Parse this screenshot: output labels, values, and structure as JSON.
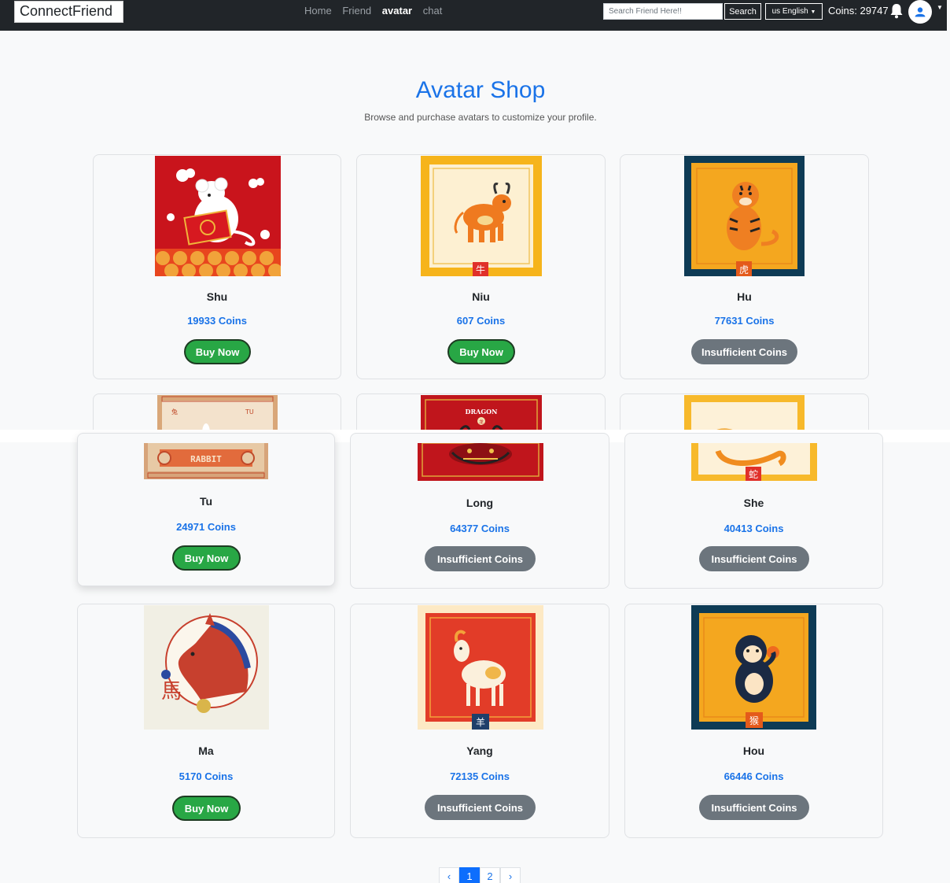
{
  "navbar": {
    "brand": "ConnectFriend",
    "links": [
      {
        "label": "Home",
        "active": false
      },
      {
        "label": "Friend",
        "active": false
      },
      {
        "label": "avatar",
        "active": true
      },
      {
        "label": "chat",
        "active": false
      }
    ],
    "search_placeholder": "Search Friend Here!!",
    "search_button": "Search",
    "language_button": "us English",
    "coins": "Coins: 29747"
  },
  "header": {
    "title": "Avatar Shop",
    "subtitle": "Browse and purchase avatars to customize your profile."
  },
  "avatars": [
    {
      "name": "Shu",
      "price": "19933 Coins",
      "action": "Buy Now",
      "can_buy": true
    },
    {
      "name": "Niu",
      "price": "607 Coins",
      "action": "Buy Now",
      "can_buy": true
    },
    {
      "name": "Hu",
      "price": "77631 Coins",
      "action": "Insufficient Coins",
      "can_buy": false
    },
    {
      "name": "Tu",
      "price": "24971 Coins",
      "action": "Buy Now",
      "can_buy": true
    },
    {
      "name": "Long",
      "price": "64377 Coins",
      "action": "Insufficient Coins",
      "can_buy": false
    },
    {
      "name": "She",
      "price": "40413 Coins",
      "action": "Insufficient Coins",
      "can_buy": false
    },
    {
      "name": "Ma",
      "price": "5170 Coins",
      "action": "Buy Now",
      "can_buy": true
    },
    {
      "name": "Yang",
      "price": "72135 Coins",
      "action": "Insufficient Coins",
      "can_buy": false
    },
    {
      "name": "Hou",
      "price": "66446 Coins",
      "action": "Insufficient Coins",
      "can_buy": false
    }
  ],
  "image_text": {
    "niu_glyph": "牛",
    "hu_glyph": "虎",
    "tu_top_left": "兔",
    "tu_top_right": "TU",
    "tu_banner": "RABBIT",
    "long_banner": "DRAGON",
    "long_glyph": "龙",
    "she_glyph": "蛇",
    "ma_glyph": "馬",
    "yang_glyph": "羊",
    "hou_glyph": "猴"
  },
  "pagination": {
    "prev": "‹",
    "pages": [
      "1",
      "2"
    ],
    "current": "1",
    "next": "›"
  },
  "colors": {
    "accent": "#1a73e8",
    "buy": "#28a745",
    "insufficient": "#6c757d",
    "navbar": "#212529"
  }
}
